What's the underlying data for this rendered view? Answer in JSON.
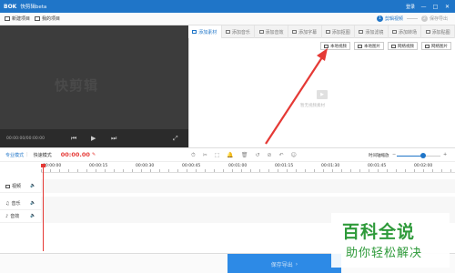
{
  "titlebar": {
    "logo": "BOK",
    "title": "快剪辑beta",
    "login": "登录",
    "min": "—",
    "max": "□",
    "close": "✕"
  },
  "toolbar": {
    "new_project": "新建项目",
    "my_projects": "我的项目",
    "steps": [
      {
        "num": "1",
        "label": "剪辑视频",
        "active": true
      },
      {
        "num": "2",
        "label": "保存导出",
        "active": false
      }
    ]
  },
  "preview": {
    "watermark": "快剪辑",
    "time": "00:00:00/00:00:00",
    "prev": "⏮",
    "play": "▶",
    "next": "⏭",
    "fullscreen": "⤢"
  },
  "tabs": [
    {
      "label": "添加素材",
      "active": true
    },
    {
      "label": "添加音乐",
      "active": false
    },
    {
      "label": "添加音效",
      "active": false
    },
    {
      "label": "添加字幕",
      "active": false
    },
    {
      "label": "添加抠图",
      "active": false
    },
    {
      "label": "添加滤镜",
      "active": false
    },
    {
      "label": "添加转场",
      "active": false
    },
    {
      "label": "添加贴图",
      "active": false
    }
  ],
  "panel": {
    "buttons": [
      "本地视频",
      "本地图片",
      "网络视频",
      "网络图片"
    ],
    "empty_text": "暂无视频素材"
  },
  "timeline_toolbar": {
    "mode_pro": "专业模式",
    "mode_fast": "快速模式",
    "timecode": "00:00.00",
    "pencil": "✎",
    "tools": [
      "⏱",
      "✂",
      "⬚",
      "🔔",
      "🗑",
      "↺",
      "⊘",
      "↶",
      "☺"
    ],
    "zoom_label": "时间轴缩放",
    "zoom_level": 0.6
  },
  "ruler": {
    "labels": [
      "00:00:00",
      "00:00:15",
      "00:00:30",
      "00:00:45",
      "00:01:00",
      "00:01:15",
      "00:01:30",
      "00:01:45",
      "00:02:00"
    ]
  },
  "tracks": [
    {
      "label": "视频",
      "speaker": "🔈"
    },
    {
      "label": "音乐",
      "speaker": "🔈"
    },
    {
      "label": "音效",
      "speaker": "🔈"
    }
  ],
  "bottom": {
    "export": "保存导出",
    "chevron": "›"
  },
  "badge": {
    "main": "百科全说",
    "sub": "助你轻松解决"
  },
  "colors": {
    "brand": "#1f75c8",
    "accent_red": "#e53935",
    "badge_green": "#2e9a3a"
  }
}
